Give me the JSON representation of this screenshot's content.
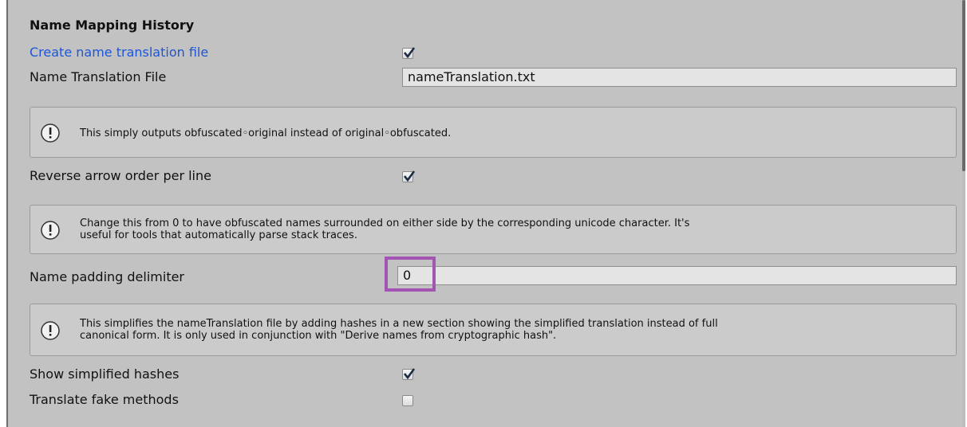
{
  "section": {
    "title": "Name Mapping History"
  },
  "fields": {
    "create_translation": {
      "label": "Create name translation file",
      "checked": true
    },
    "translation_file": {
      "label": "Name Translation File",
      "value": "nameTranslation.txt"
    },
    "reverse_arrow": {
      "label": "Reverse arrow order per line",
      "checked": true
    },
    "padding_delimiter": {
      "label": "Name padding delimiter",
      "value": "0"
    },
    "show_hashes": {
      "label": "Show simplified hashes",
      "checked": true
    },
    "translate_fake": {
      "label": "Translate fake methods",
      "checked": false
    }
  },
  "help": {
    "arrow": "This simply outputs obfuscated◦original instead of original◦obfuscated.",
    "padding": "Change this from 0 to have obfuscated names surrounded on either side by the corresponding unicode character. It's\nuseful for tools that automatically parse stack traces.",
    "hashes": "This simplifies the nameTranslation file by adding hashes in a new section showing the simplified translation instead of full\ncanonical form. It is only used in conjunction with \"Derive names from cryptographic hash\"."
  },
  "icons": {
    "info": "info-icon",
    "check": "checkmark-icon"
  },
  "colors": {
    "link": "#1d56d6",
    "highlight": "#a455b4",
    "panel": "#c2c2c2"
  }
}
